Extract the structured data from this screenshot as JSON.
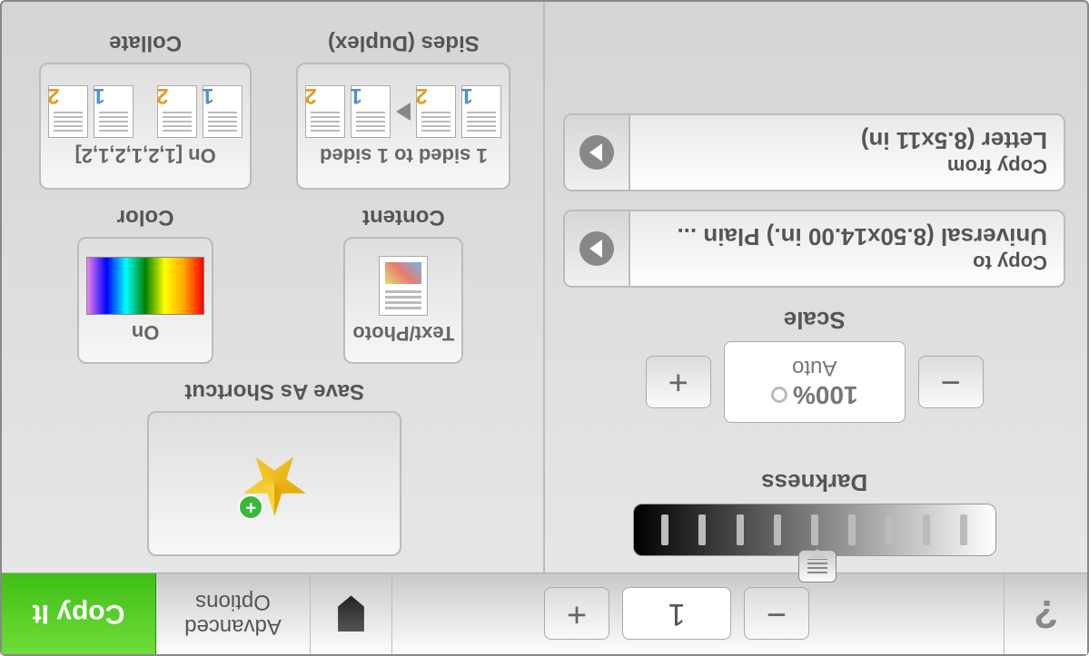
{
  "topbar": {
    "help": "?",
    "quantity": "1",
    "advanced_line1": "Advanced",
    "advanced_line2": "Options",
    "copy_it": "Copy It"
  },
  "darkness": {
    "label": "Darkness"
  },
  "scale": {
    "label": "Scale",
    "percent": "100%",
    "auto": "Auto"
  },
  "copy_from": {
    "label": "Copy from",
    "value": "Letter (8.5x11 in)"
  },
  "copy_to": {
    "label": "Copy to",
    "value": "Universal (8.50x14.00 in.) Plain ..."
  },
  "save_shortcut": {
    "label": "Save As Shortcut"
  },
  "content": {
    "label": "Content",
    "status": "Text/Photo"
  },
  "color": {
    "label": "Color",
    "status": "On"
  },
  "sides": {
    "label": "Sides (Duplex)",
    "status": "1 sided to 1 sided"
  },
  "collate": {
    "label": "Collate",
    "status": "On [1,2,1,2,1,2]"
  }
}
